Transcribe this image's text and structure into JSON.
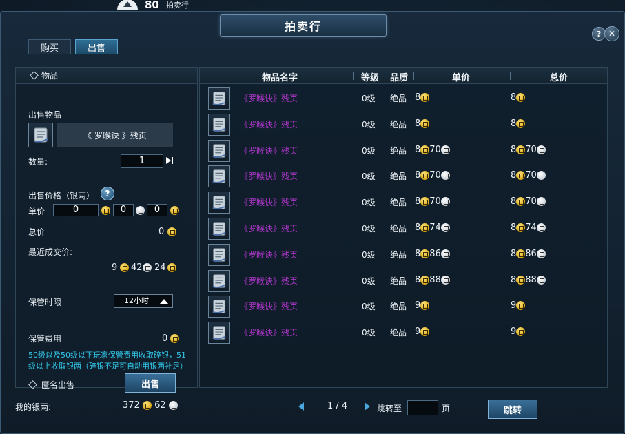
{
  "topbar": {
    "level": "80",
    "label": "拍卖行"
  },
  "window": {
    "title": "拍卖行",
    "help": "?",
    "close": "✕"
  },
  "tabs": [
    {
      "label": "购买",
      "active": false
    },
    {
      "label": "出售",
      "active": true
    }
  ],
  "left": {
    "section_title": "物品",
    "sell_item_label": "出售物品",
    "item_name": "《 罗睺诀 》残页",
    "qty_label": "数量:",
    "qty_value": "1",
    "price_section_label": "出售价格（银两）",
    "unit_price_label": "单价",
    "unit_price": {
      "gold": "0",
      "silver": "0",
      "copper": "0"
    },
    "total_label": "总价",
    "total_value": "0",
    "recent_label": "最近成交价:",
    "recent": {
      "gold": "9",
      "silver": "42",
      "copper": "24"
    },
    "storage_label": "保管时限",
    "storage_value": "12小时",
    "fee_label": "保管费用",
    "fee_value": "0",
    "note": "50级以及50级以下玩家保管费用收取碎银，51级以上收取银两（碎银不足可自动用银两补足）",
    "anon_label": "匿名出售",
    "sell_button": "出售"
  },
  "table": {
    "headers": {
      "name": "物品名字",
      "level": "等级",
      "quality": "品质",
      "unit": "单价",
      "total": "总价"
    },
    "rows": [
      {
        "name": "《罗睺诀》残页",
        "level": "0级",
        "quality": "绝品",
        "unit_g": "8",
        "unit_s": "",
        "total_g": "8",
        "total_s": ""
      },
      {
        "name": "《罗睺诀》残页",
        "level": "0级",
        "quality": "绝品",
        "unit_g": "8",
        "unit_s": "",
        "total_g": "8",
        "total_s": ""
      },
      {
        "name": "《罗睺诀》残页",
        "level": "0级",
        "quality": "绝品",
        "unit_g": "8",
        "unit_s": "70",
        "total_g": "8",
        "total_s": "70"
      },
      {
        "name": "《罗睺诀》残页",
        "level": "0级",
        "quality": "绝品",
        "unit_g": "8",
        "unit_s": "70",
        "total_g": "8",
        "total_s": "70"
      },
      {
        "name": "《罗睺诀》残页",
        "level": "0级",
        "quality": "绝品",
        "unit_g": "8",
        "unit_s": "70",
        "total_g": "8",
        "total_s": "70"
      },
      {
        "name": "《罗睺诀》残页",
        "level": "0级",
        "quality": "绝品",
        "unit_g": "8",
        "unit_s": "74",
        "total_g": "8",
        "total_s": "74"
      },
      {
        "name": "《罗睺诀》残页",
        "level": "0级",
        "quality": "绝品",
        "unit_g": "8",
        "unit_s": "86",
        "total_g": "8",
        "total_s": "86"
      },
      {
        "name": "《罗睺诀》残页",
        "level": "0级",
        "quality": "绝品",
        "unit_g": "8",
        "unit_s": "88",
        "total_g": "8",
        "total_s": "88"
      },
      {
        "name": "《罗睺诀》残页",
        "level": "0级",
        "quality": "绝品",
        "unit_g": "9",
        "unit_s": "",
        "total_g": "9",
        "total_s": ""
      },
      {
        "name": "《罗睺诀》残页",
        "level": "0级",
        "quality": "绝品",
        "unit_g": "9",
        "unit_s": "",
        "total_g": "9",
        "total_s": ""
      }
    ]
  },
  "footer": {
    "money_label": "我的银两:",
    "money_gold": "372",
    "money_silver": "62",
    "page_text": "1 / 4",
    "jump_label": "跳转至",
    "page_unit": "页",
    "jump_value": "",
    "jump_button": "跳转"
  },
  "icons": {
    "scroll": "scroll-icon",
    "gold_coin": "gold-coin-icon",
    "silver_coin": "silver-coin-icon"
  }
}
